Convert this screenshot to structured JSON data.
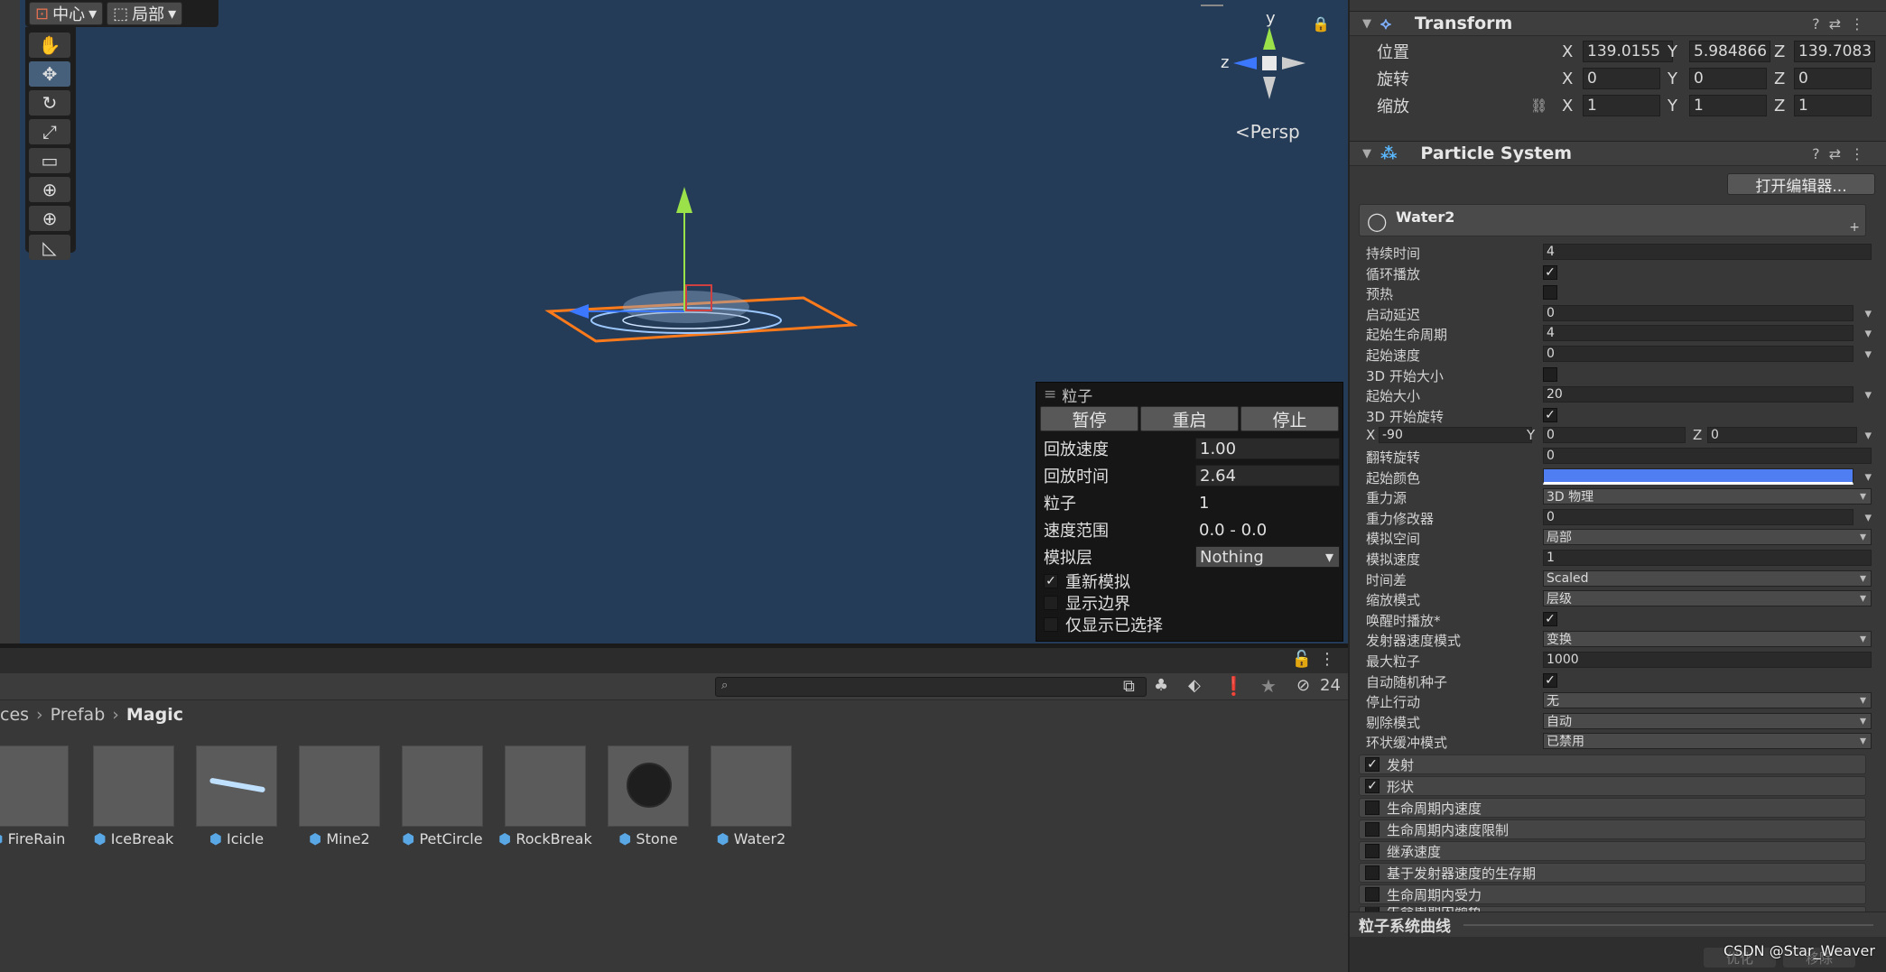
{
  "scene": {
    "pivot_center_label": "中心",
    "pivot_local_label": "局部",
    "persp_label": "Persp",
    "gizmo": {
      "y": "y",
      "z": "z"
    },
    "tools": [
      "hand-icon",
      "move-icon",
      "rotate-icon",
      "scale-icon",
      "rect-icon",
      "transform-icon",
      "custom-tool-icon",
      "edit-tool-icon"
    ]
  },
  "particle_window": {
    "title": "粒子",
    "buttons": {
      "pause": "暂停",
      "restart": "重启",
      "stop": "停止"
    },
    "rows": [
      {
        "label": "回放速度",
        "value": "1.00",
        "field": true
      },
      {
        "label": "回放时间",
        "value": "2.64",
        "field": true
      },
      {
        "label": "粒子",
        "value": "1",
        "field": false
      },
      {
        "label": "速度范围",
        "value": "0.0 - 0.0",
        "field": false
      }
    ],
    "sim_layer_label": "模拟层",
    "sim_layer_value": "Nothing",
    "checks": [
      {
        "label": "重新模拟",
        "checked": true
      },
      {
        "label": "显示边界",
        "checked": false
      },
      {
        "label": "仅显示已选择",
        "checked": false
      }
    ]
  },
  "project": {
    "hidden_count": "24",
    "breadcrumb": [
      "ces",
      "Prefab",
      "Magic"
    ],
    "assets": [
      "FireRain",
      "IceBreak",
      "Icicle",
      "Mine2",
      "PetCircle",
      "RockBreak",
      "Stone",
      "Water2"
    ]
  },
  "inspector": {
    "transform": {
      "title": "Transform",
      "position_label": "位置",
      "rotation_label": "旋转",
      "scale_label": "缩放",
      "position": {
        "x": "139.0155",
        "y": "5.984866",
        "z": "139.7083"
      },
      "rotation": {
        "x": "0",
        "y": "0",
        "z": "0"
      },
      "scale": {
        "x": "1",
        "y": "1",
        "z": "1"
      },
      "axis": {
        "x": "X",
        "y": "Y",
        "z": "Z"
      }
    },
    "particle_system": {
      "title": "Particle System",
      "open_editor": "打开编辑器...",
      "system_name": "Water2",
      "rows": [
        {
          "label": "持续时间",
          "type": "field",
          "value": "4"
        },
        {
          "label": "循环播放",
          "type": "check",
          "checked": true
        },
        {
          "label": "预热",
          "type": "check",
          "checked": false
        },
        {
          "label": "启动延迟",
          "type": "curve",
          "value": "0"
        },
        {
          "label": "起始生命周期",
          "type": "curve",
          "value": "4"
        },
        {
          "label": "起始速度",
          "type": "curve",
          "value": "0"
        },
        {
          "label": "3D 开始大小",
          "type": "check",
          "checked": false
        },
        {
          "label": "起始大小",
          "type": "curve",
          "value": "20"
        },
        {
          "label": "3D 开始旋转",
          "type": "check",
          "checked": true
        },
        {
          "label": "",
          "type": "xyz",
          "x": "-90",
          "y": "0",
          "z": "0"
        },
        {
          "label": "翻转旋转",
          "type": "field",
          "value": "0"
        },
        {
          "label": "起始颜色",
          "type": "color",
          "value": "#4f7ef2"
        },
        {
          "label": "重力源",
          "type": "dropdown",
          "value": "3D 物理"
        },
        {
          "label": "重力修改器",
          "type": "curve",
          "value": "0"
        },
        {
          "label": "模拟空间",
          "type": "dropdown",
          "value": "局部"
        },
        {
          "label": "模拟速度",
          "type": "field",
          "value": "1"
        },
        {
          "label": "时间差",
          "type": "dropdown",
          "value": "Scaled"
        },
        {
          "label": "缩放模式",
          "type": "dropdown",
          "value": "层级"
        },
        {
          "label": "唤醒时播放*",
          "type": "check",
          "checked": true
        },
        {
          "label": "发射器速度模式",
          "type": "dropdown",
          "value": "变换"
        },
        {
          "label": "最大粒子",
          "type": "field",
          "value": "1000"
        },
        {
          "label": "自动随机种子",
          "type": "check",
          "checked": true
        },
        {
          "label": "停止行动",
          "type": "dropdown",
          "value": "无"
        },
        {
          "label": "剔除模式",
          "type": "dropdown",
          "value": "自动"
        },
        {
          "label": "环状缓冲模式",
          "type": "dropdown",
          "value": "已禁用"
        }
      ],
      "modules": [
        {
          "label": "发射",
          "checked": true
        },
        {
          "label": "形状",
          "checked": true
        },
        {
          "label": "生命周期内速度",
          "checked": false
        },
        {
          "label": "生命周期内速度限制",
          "checked": false
        },
        {
          "label": "继承速度",
          "checked": false
        },
        {
          "label": "基于发射器速度的生存期",
          "checked": false
        },
        {
          "label": "生命周期内受力",
          "checked": false
        },
        {
          "label": "生命周期内颜色",
          "checked": false
        }
      ],
      "curves_title": "粒子系统曲线"
    },
    "footer": {
      "optimize": "优化",
      "remove": "移除"
    },
    "watermark": "CSDN @Star_Weaver"
  }
}
